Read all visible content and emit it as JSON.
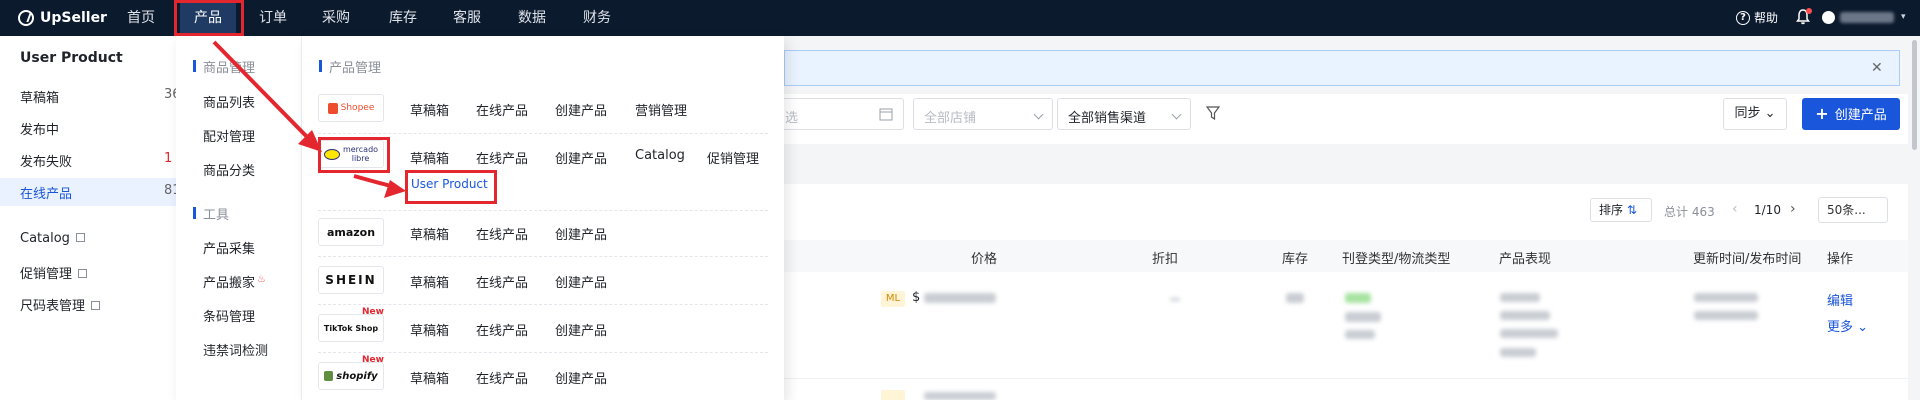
{
  "topbar": {
    "brand": "UpSeller",
    "nav": [
      "首页",
      "产品",
      "订单",
      "采购",
      "库存",
      "客服",
      "数据",
      "财务"
    ],
    "active_nav": "产品",
    "help_label": "帮助"
  },
  "sidebar": {
    "title": "User Product",
    "items": [
      {
        "label": "草稿箱",
        "count": "36"
      },
      {
        "label": "发布中",
        "count": ""
      },
      {
        "label": "发布失败",
        "count": "1"
      },
      {
        "label": "在线产品",
        "count": "81"
      }
    ],
    "links": [
      "Catalog",
      "促销管理",
      "尺码表管理"
    ]
  },
  "dropdown": {
    "section_goods": "商品管理",
    "goods_items": [
      "商品列表",
      "配对管理",
      "商品分类"
    ],
    "section_tools": "工具",
    "tool_items": [
      "产品采集",
      "产品搬家",
      "条码管理",
      "违禁词检测"
    ],
    "section_products": "产品管理",
    "platforms": [
      {
        "logo": "Shopee",
        "links": [
          "草稿箱",
          "在线产品",
          "创建产品",
          "营销管理"
        ],
        "new": ""
      },
      {
        "logo": "mercado libre",
        "links": [
          "草稿箱",
          "在线产品",
          "创建产品",
          "Catalog",
          "促销管理"
        ],
        "sublink": "User Product",
        "new": ""
      },
      {
        "logo": "amazon",
        "links": [
          "草稿箱",
          "在线产品",
          "创建产品"
        ],
        "new": ""
      },
      {
        "logo": "SHEIN",
        "links": [
          "草稿箱",
          "在线产品",
          "创建产品"
        ],
        "new": ""
      },
      {
        "logo": "TikTok Shop",
        "links": [
          "草稿箱",
          "在线产品",
          "创建产品"
        ],
        "new": "New"
      },
      {
        "logo": "shopify",
        "links": [
          "草稿箱",
          "在线产品",
          "创建产品"
        ],
        "new": "New"
      }
    ]
  },
  "filters": {
    "date_placeholder": "选",
    "store_placeholder": "全部店铺",
    "channel_value": "全部销售渠道",
    "sync_label": "同步",
    "create_label": "创建产品"
  },
  "table_toolbar": {
    "sort_label": "排序",
    "total": "总计 463",
    "page": "1/10",
    "per_page": "50条..."
  },
  "table": {
    "headers": [
      "价格",
      "折扣",
      "库存",
      "刊登类型/物流类型",
      "产品表现",
      "更新时间/发布时间",
      "操作"
    ],
    "row": {
      "site_tag": "ML",
      "currency": "$",
      "edit_label": "编辑",
      "more_label": "更多"
    }
  },
  "colors": {
    "accent": "#1a56db",
    "nav_bg": "#0c1a2e",
    "annotation": "#e4262f"
  }
}
